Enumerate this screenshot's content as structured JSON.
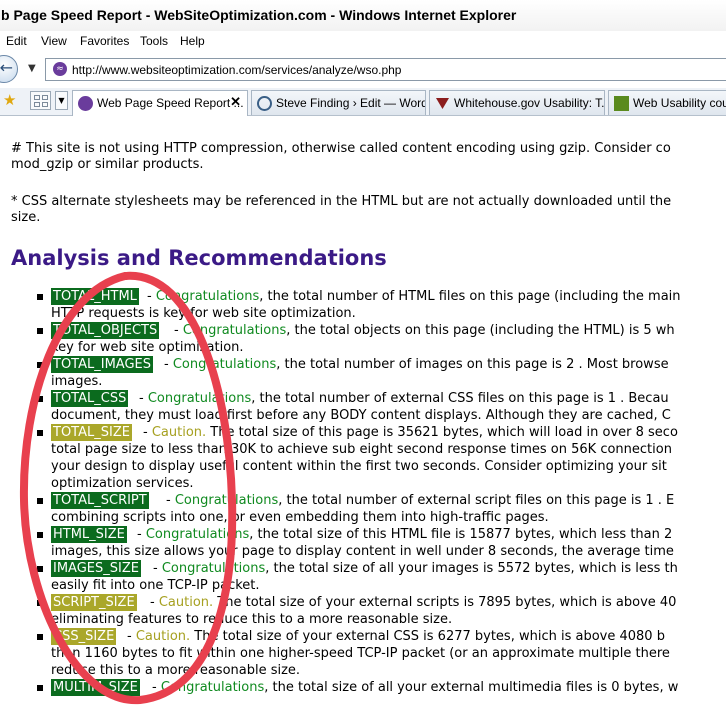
{
  "window": {
    "title": "b Page Speed Report - WebSiteOptimization.com - Windows Internet Explorer"
  },
  "menu": [
    "Edit",
    "View",
    "Favorites",
    "Tools",
    "Help"
  ],
  "address": {
    "url": "http://www.websiteoptimization.com/services/analyze/wso.php"
  },
  "tabs": [
    {
      "label": "Web Page Speed Report ...",
      "active": true
    },
    {
      "label": "Steve Finding › Edit — Word..."
    },
    {
      "label": "Whitehouse.gov Usability: T..."
    },
    {
      "label": "Web Usability cour"
    }
  ],
  "content": {
    "notes": [
      {
        "line1": "# This site is not using HTTP compression, otherwise called content encoding using gzip. Consider co",
        "line2": "mod_gzip or similar products."
      },
      {
        "line1": "* CSS alternate stylesheets may be referenced in the HTML but are not actually downloaded until the",
        "line2": "size."
      }
    ],
    "heading": "Analysis and Recommendations",
    "recommendations": [
      {
        "tag": "TOTAL_HTML",
        "level": "green",
        "status": "Congratulations",
        "text": ", the total number of HTML files on this page (including the main",
        "line2": "HTTP requests is key for web site optimization."
      },
      {
        "tag": "TOTAL_OBJECTS",
        "level": "green",
        "status": "Congratulations",
        "text": ", the total objects on this page (including the HTML) is 5 wh",
        "line2": "key for web site optimization."
      },
      {
        "tag": "TOTAL_IMAGES",
        "level": "green",
        "status": "Congratulations",
        "text": ", the total number of images on this page is 2 . Most browse",
        "line2": "images."
      },
      {
        "tag": "TOTAL_CSS",
        "level": "green",
        "status": "Congratulations",
        "text": ", the total number of external CSS files on this page is 1 . Becau",
        "line2": "document, they must load first before any BODY content displays. Although they are cached, C"
      },
      {
        "tag": "TOTAL_SIZE",
        "level": "yellow",
        "status": "Caution.",
        "text": " The total size of this page is 35621 bytes, which will load in over 8 seco",
        "line2": "total page size to less than 30K to achieve sub eight second response times on 56K connection",
        "line3": "your design to display useful content within the first two seconds. Consider optimizing your sit",
        "line4": "optimization services."
      },
      {
        "tag": "TOTAL_SCRIPT",
        "level": "green",
        "status": "Congratulations",
        "text": ", the total number of external script files on this page is 1 . E",
        "line2": "combining scripts into one, or even embedding them into high-traffic pages."
      },
      {
        "tag": "HTML_SIZE",
        "level": "green",
        "status": "Congratulations",
        "text": ", the total size of this HTML file is 15877 bytes, which less than 2",
        "line2": "images, this size allows your page to display content in well under 8 seconds, the average time"
      },
      {
        "tag": "IMAGES_SIZE",
        "level": "green",
        "status": "Congratulations",
        "text": ", the total size of all your images is 5572 bytes, which is less th",
        "line2": "easily fit into one TCP-IP packet."
      },
      {
        "tag": "SCRIPT_SIZE",
        "level": "yellow",
        "status": "Caution.",
        "text": " The total size of your external scripts is 7895 bytes, which is above 40",
        "line2": "eliminating features to reduce this to a more reasonable size."
      },
      {
        "tag": "CSS_SIZE",
        "level": "yellow",
        "status": "Caution.",
        "text": " The total size of your external CSS is 6277 bytes, which is above 4080 b",
        "line2": "than 1160 bytes to fit within one higher-speed TCP-IP packet (or an approximate multiple there",
        "line3": "reduce this to a more reasonable size."
      },
      {
        "tag": "MULTIM_SIZE",
        "level": "green",
        "status": "Congratulations",
        "text": ", the total size of all your external multimedia files is 0 bytes, w"
      }
    ]
  },
  "colors": {
    "heading": "#3b1a86",
    "tag_green": "#0b6b1e",
    "tag_yellow": "#aaa72a",
    "annotation": "#e8404e"
  }
}
